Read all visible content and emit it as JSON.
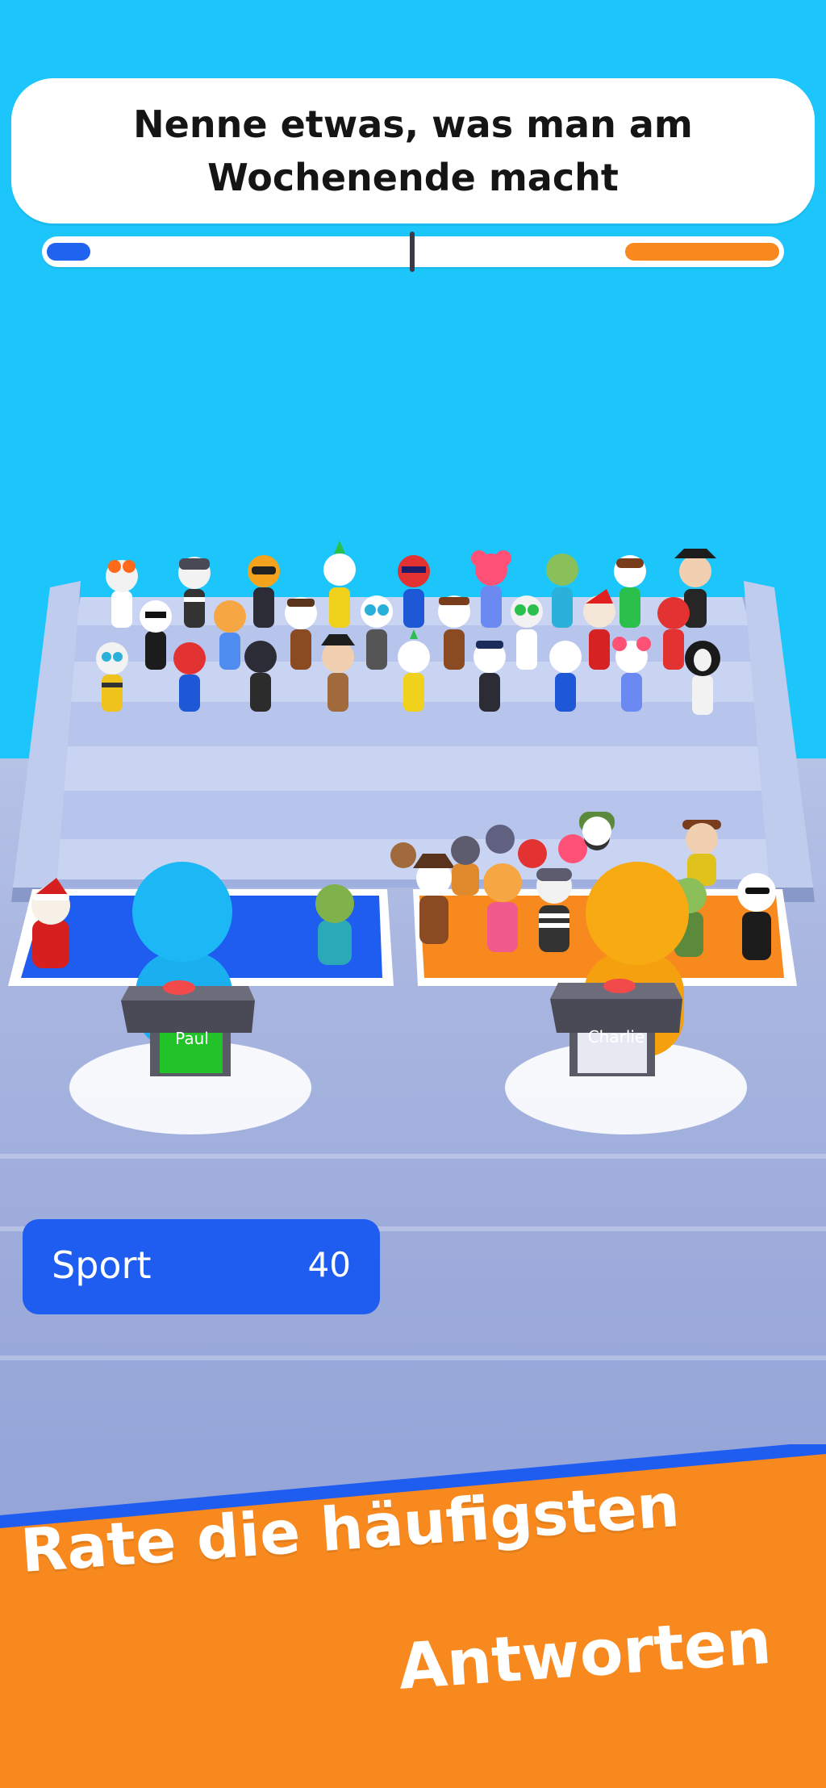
{
  "question": {
    "text": "Nenne etwas, was man am Wochenende macht"
  },
  "timer": {
    "blue_fraction": 0.06,
    "orange_fraction": 0.21
  },
  "players": [
    {
      "name": "Paul",
      "team_color": "#1f5cf0",
      "podium_light": "#22c229"
    },
    {
      "name": "Charlie",
      "team_color": "#f7891f",
      "podium_light": "#e6e9f2"
    }
  ],
  "answer": {
    "label": "Sport",
    "points": "40"
  },
  "banner": {
    "line1": "Rate die häufigsten",
    "line2": "Antworten",
    "background": "#f7891f",
    "stripe": "#1f5cf0"
  },
  "colors": {
    "sky": "#1cc6fb",
    "blue_team": "#1f5cf0",
    "orange_team": "#f7891f"
  }
}
